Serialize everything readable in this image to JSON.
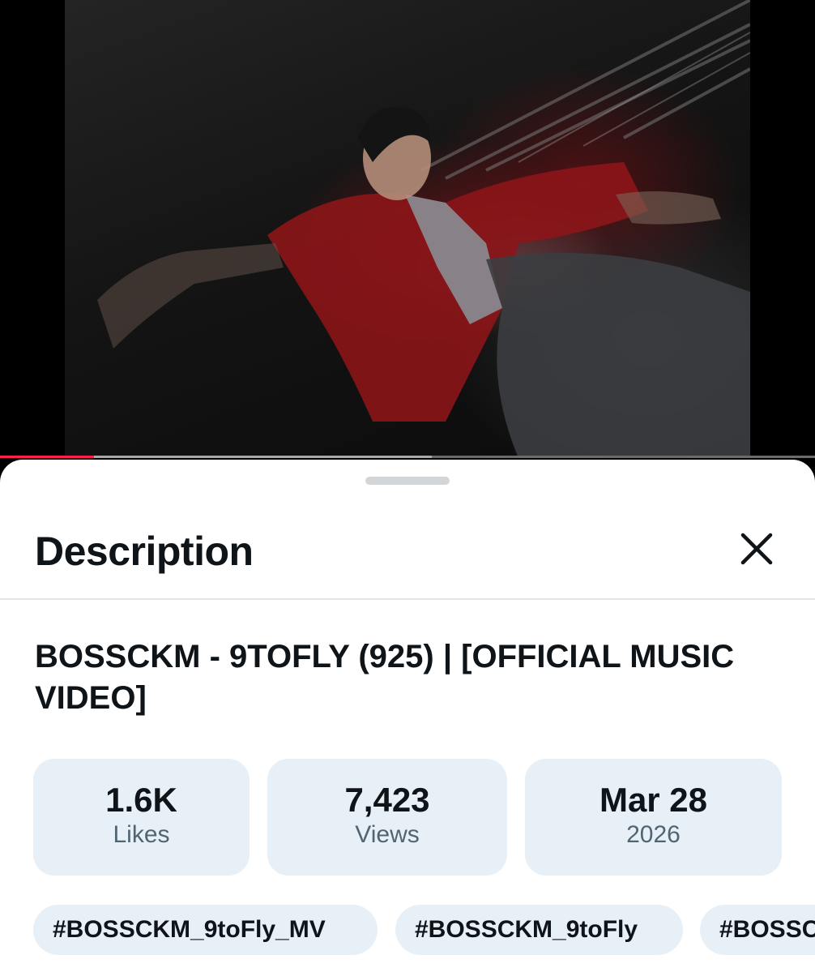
{
  "video": {
    "progress": {
      "played_fraction": 0.115,
      "buffered_fraction": 0.53
    }
  },
  "sheet": {
    "title": "Description",
    "close_icon": "close-x-icon"
  },
  "post": {
    "title": "BOSSCKM - 9TOFLY (925) | [OFFICIAL MUSIC VIDEO]",
    "stats": [
      {
        "value": "1.6K",
        "label": "Likes"
      },
      {
        "value": "7,423",
        "label": "Views"
      },
      {
        "value": "Mar 28",
        "label": "2026"
      }
    ],
    "hashtags": [
      "#BOSSCKM_9toFly_MV",
      "#BOSSCKM_9toFly",
      "#BOSSCKM"
    ]
  },
  "colors": {
    "progress_played": "#ff1f4d",
    "pill_background": "#e7f0f7",
    "text_primary": "#0f1419",
    "text_secondary": "#536471"
  }
}
